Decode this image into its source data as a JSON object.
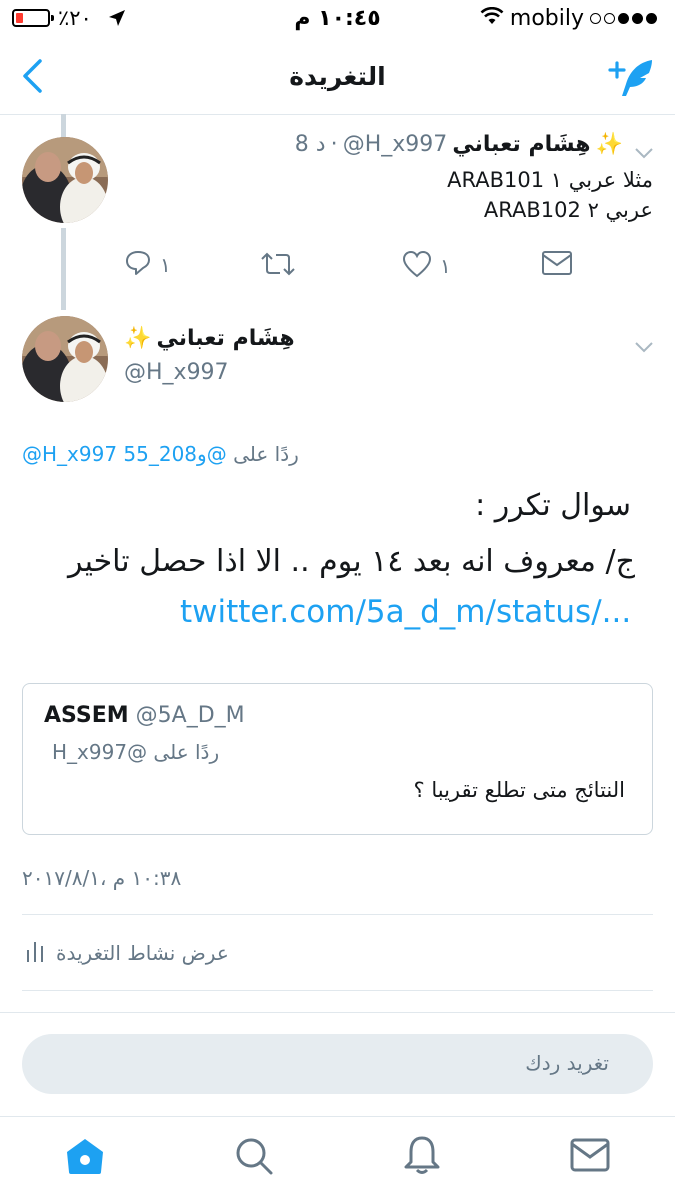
{
  "status_bar": {
    "battery_text": "٪٢٠",
    "time": "١٠:٤٥ م",
    "carrier": "mobily",
    "battery_level": 0.2,
    "signal_dots_filled": 3
  },
  "nav": {
    "title": "التغريدة"
  },
  "parent_tweet": {
    "display_name": "هِشَام تعباني",
    "name_emoji": "✨",
    "handle": "@H_x997",
    "time_ago": "8 د",
    "line1": "مثلا عربي ١ ARAB101",
    "line2": "عربي ٢ ARAB102",
    "reply_count": "١",
    "like_count": "١"
  },
  "main_tweet": {
    "display_name": "هِشَام تعباني",
    "name_emoji": "✨",
    "handle": "@H_x997",
    "replying_prefix": "ردًا على",
    "replying_users": "@H_x997 و208_55@",
    "body_line1": "سوال تكرر :",
    "body_line2": "ج/ معروف انه بعد ١٤ يوم .. الا اذا حصل تاخير",
    "link": "twitter.com/5a_d_m/status/..."
  },
  "quoted_tweet": {
    "name": "ASSEM",
    "handle": "@5A_D_M",
    "replying": "ردًا على @H_x997",
    "text": "النتائج متى تطلع تقريبا ؟"
  },
  "timestamp": "١٠:٣٨ م ،٢٠١٧/٨/١",
  "activity_label": "عرض نشاط التغريدة",
  "reply_placeholder": "تغريد ردك",
  "colors": {
    "accent": "#1da1f2",
    "secondary_text": "#657786",
    "divider": "#e1e8ed"
  }
}
